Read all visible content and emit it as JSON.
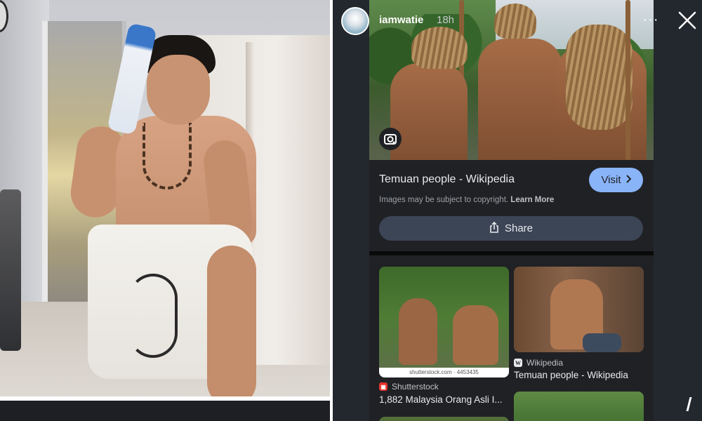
{
  "story": {
    "username": "iamwatie",
    "timestamp": "18h",
    "more_label": "···",
    "close_icon": "close-icon"
  },
  "result": {
    "title": "Temuan people - Wikipedia",
    "visit_label": "Visit",
    "copyright_text": "Images may be subject to copyright.",
    "learn_more_label": "Learn More",
    "share_label": "Share"
  },
  "related": [
    {
      "watermark": "shutterstock.com · 4453435",
      "source": "Shutterstock",
      "title": "1,882 Malaysia Orang Asli I..."
    },
    {
      "source": "Wikipedia",
      "title": "Temuan people - Wikipedia"
    }
  ],
  "colors": {
    "story_background": "#23272e",
    "card_background": "#202124",
    "visit_button": "#8ab4f8",
    "share_button": "#3c4556",
    "shutterstock_red": "#e3312d"
  }
}
